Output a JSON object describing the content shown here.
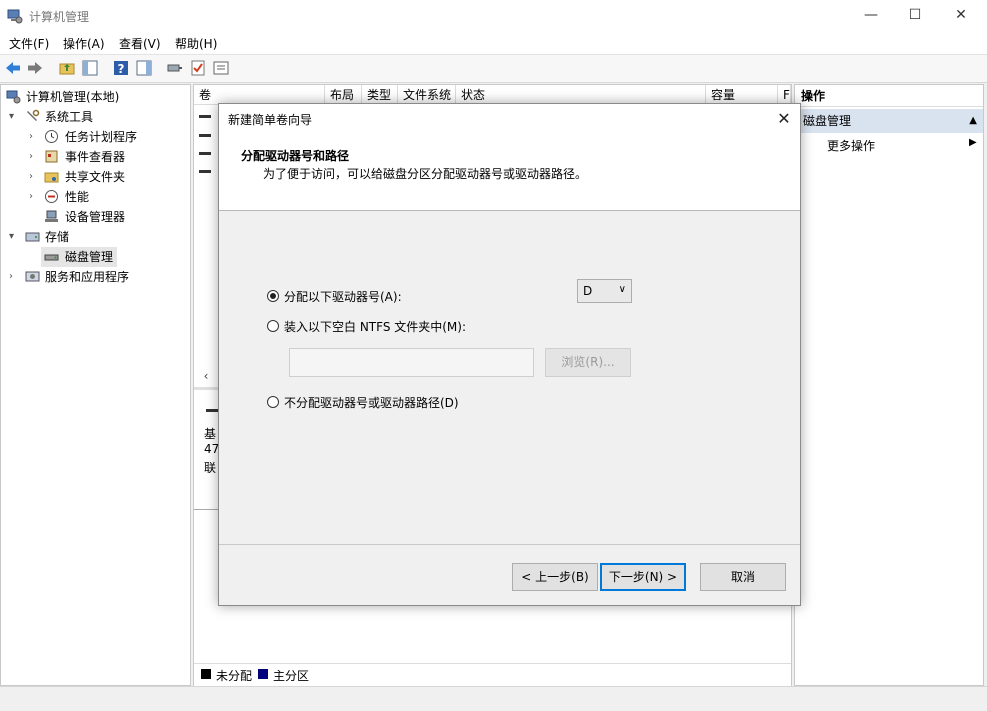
{
  "window": {
    "title": "计算机管理",
    "controls": {
      "minimize": "—",
      "maximize": "☐",
      "close": "✕"
    }
  },
  "menu": [
    "文件(F)",
    "操作(A)",
    "查看(V)",
    "帮助(H)"
  ],
  "toolbar_icons": [
    "back-icon",
    "forward-icon",
    "up-folder-icon",
    "show-tree-icon",
    "help-icon",
    "show-action-icon",
    "connect-icon",
    "check-icon",
    "properties-icon"
  ],
  "tree": {
    "root": "计算机管理(本地)",
    "system_tools": "系统工具",
    "task_scheduler": "任务计划程序",
    "event_viewer": "事件查看器",
    "shared_folders": "共享文件夹",
    "performance": "性能",
    "device_manager": "设备管理器",
    "storage": "存储",
    "disk_management": "磁盘管理",
    "services": "服务和应用程序"
  },
  "center": {
    "columns": [
      "卷",
      "布局",
      "类型",
      "文件系统",
      "状态",
      "容量",
      "F"
    ],
    "disk_info": [
      "基",
      "47",
      "联"
    ],
    "legend": {
      "unallocated": "未分配",
      "primary": "主分区"
    },
    "legend_colors": {
      "unallocated": "#000000",
      "primary": "#00007a"
    }
  },
  "actions": {
    "header": "操作",
    "section": "磁盘管理",
    "more": "更多操作"
  },
  "dialog": {
    "title": "新建简单卷向导",
    "heading": "分配驱动器号和路径",
    "subheading": "为了便于访问，可以给磁盘分区分配驱动器号或驱动器路径。",
    "opt_assign": "分配以下驱动器号(A):",
    "opt_mount": "装入以下空白 NTFS 文件夹中(M):",
    "opt_none": "不分配驱动器号或驱动器路径(D)",
    "drive_letter": "D",
    "path_value": "",
    "browse": "浏览(R)...",
    "back": "< 上一步(B)",
    "next": "下一步(N) >",
    "cancel": "取消",
    "selected_option": "assign"
  }
}
